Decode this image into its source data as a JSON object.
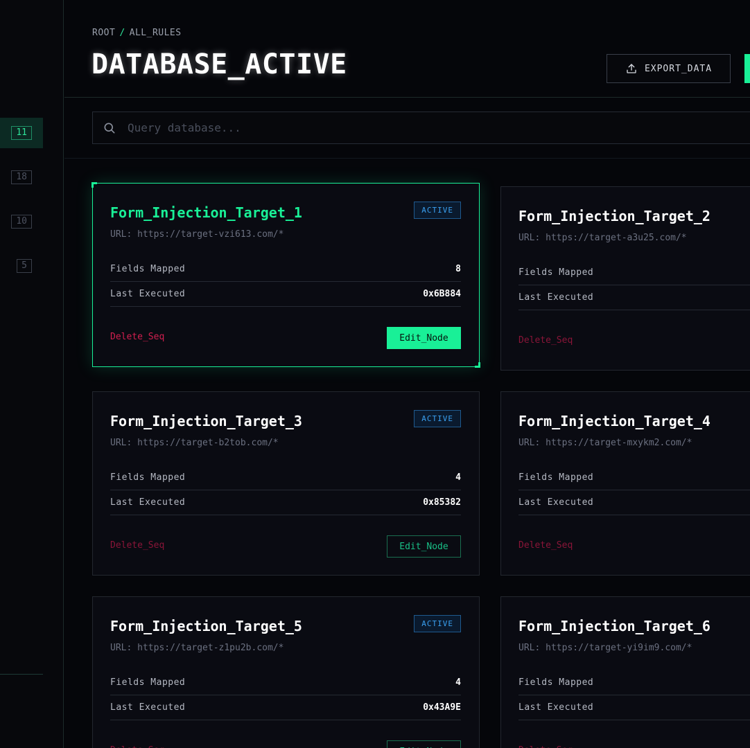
{
  "sidebar": {
    "badges": [
      "11",
      "18",
      "10",
      "5"
    ]
  },
  "header": {
    "breadcrumb_root": "ROOT",
    "breadcrumb_sep": "/",
    "breadcrumb_current": "ALL_RULES",
    "title": "DATABASE_ACTIVE",
    "export_label": "EXPORT_DATA"
  },
  "search": {
    "placeholder": "Query database..."
  },
  "labels": {
    "fields_mapped": "Fields Mapped",
    "last_executed": "Last Executed",
    "delete": "Delete_Seq",
    "edit": "Edit_Node"
  },
  "cards": [
    {
      "title": "Form_Injection_Target_1",
      "url": "URL: https://target-vzi613.com/*",
      "status": "ACTIVE",
      "fields": "8",
      "last": "0x6B884"
    },
    {
      "title": "Form_Injection_Target_2",
      "url": "URL: https://target-a3u25.com/*",
      "status": "",
      "fields": "",
      "last": ""
    },
    {
      "title": "Form_Injection_Target_3",
      "url": "URL: https://target-b2tob.com/*",
      "status": "ACTIVE",
      "fields": "4",
      "last": "0x85382"
    },
    {
      "title": "Form_Injection_Target_4",
      "url": "URL: https://target-mxykm2.com/*",
      "status": "",
      "fields": "",
      "last": ""
    },
    {
      "title": "Form_Injection_Target_5",
      "url": "URL: https://target-z1pu2b.com/*",
      "status": "ACTIVE",
      "fields": "4",
      "last": "0x43A9E"
    },
    {
      "title": "Form_Injection_Target_6",
      "url": "URL: https://target-yi9im9.com/*",
      "status": "",
      "fields": "",
      "last": ""
    }
  ],
  "colors": {
    "accent": "#19f097",
    "danger": "#d21f4f",
    "status": "#3aa0f0",
    "background": "#05060a"
  }
}
